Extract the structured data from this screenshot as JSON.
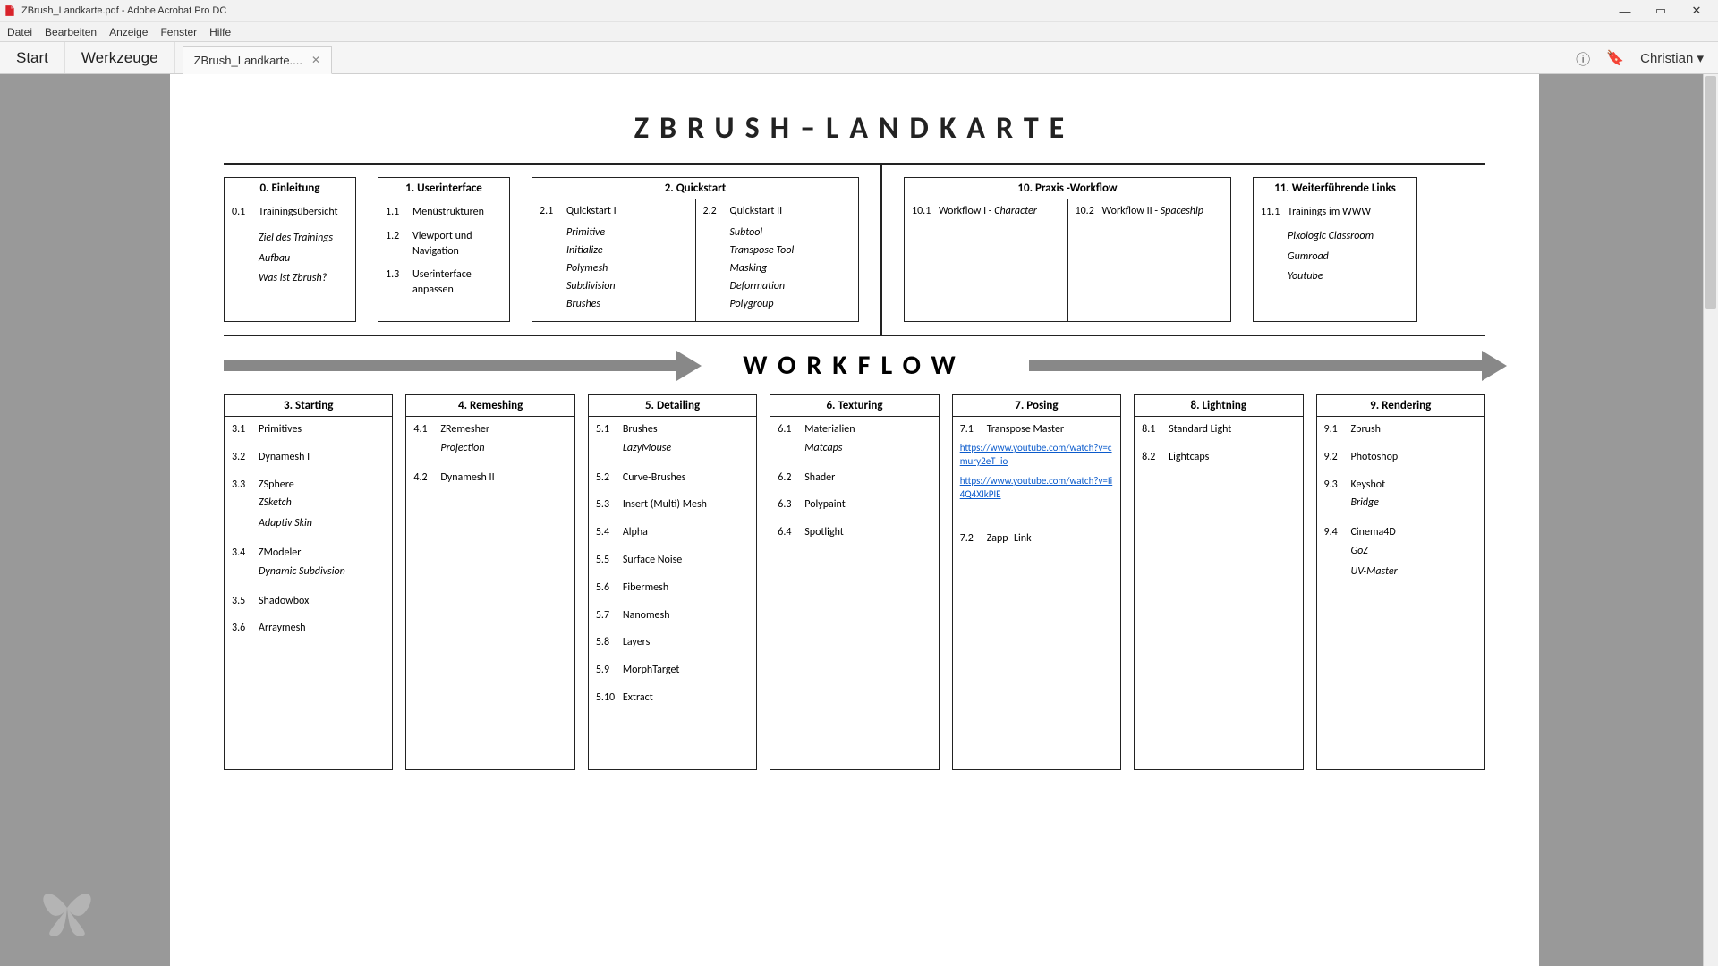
{
  "window": {
    "title": "ZBrush_Landkarte.pdf - Adobe Acrobat Pro DC"
  },
  "menu": {
    "items": [
      "Datei",
      "Bearbeiten",
      "Anzeige",
      "Fenster",
      "Hilfe"
    ]
  },
  "toolbar": {
    "start": "Start",
    "tools": "Werkzeuge",
    "tab_label": "ZBrush_Landkarte....",
    "username": "Christian"
  },
  "doc": {
    "title": "ZBRUSH–LANDKARTE",
    "workflow_label": "WORKFLOW",
    "top_cards": {
      "c0": {
        "head": "0. Einleitung",
        "rows": [
          {
            "num": "0.1",
            "label": "Trainingsübersicht"
          }
        ],
        "subs": [
          "Ziel des Trainings",
          "Aufbau",
          "Was ist Zbrush?"
        ]
      },
      "c1": {
        "head": "1. Userinterface",
        "rows": [
          {
            "num": "1.1",
            "label": "Menüstrukturen"
          },
          {
            "num": "1.2",
            "label": "Viewport und Navigation"
          },
          {
            "num": "1.3",
            "label": "Userinterface anpassen"
          }
        ]
      },
      "c2": {
        "head": "2. Quickstart",
        "col1": {
          "rows": [
            {
              "num": "2.1",
              "label": "Quickstart I"
            }
          ],
          "subs": [
            "Primitive",
            "Initialize",
            "Polymesh",
            "Subdivision",
            "Brushes"
          ]
        },
        "col2": {
          "rows": [
            {
              "num": "2.2",
              "label": "Quickstart II"
            }
          ],
          "subs": [
            "Subtool",
            "Transpose Tool",
            "Masking",
            "Deformation",
            "Polygroup"
          ]
        }
      },
      "c10": {
        "head": "10. Praxis -Workflow",
        "col1": {
          "rows": [
            {
              "num": "10.1",
              "label": "Workflow I - ",
              "em": "Character"
            }
          ]
        },
        "col2": {
          "rows": [
            {
              "num": "10.2",
              "label": "Workflow II - ",
              "em": "Spaceship"
            }
          ]
        }
      },
      "c11": {
        "head": "11. Weiterführende Links",
        "rows": [
          {
            "num": "11.1",
            "label": "Trainings im WWW"
          }
        ],
        "subs": [
          "Pixologic Classroom",
          "Gumroad",
          "Youtube"
        ]
      }
    },
    "bottom_cards": {
      "c3": {
        "head": "3. Starting",
        "items": [
          {
            "num": "3.1",
            "label": "Primitives"
          },
          {
            "num": "3.2",
            "label": "Dynamesh I"
          },
          {
            "num": "3.3",
            "label": "ZSphere",
            "subs": [
              "ZSketch",
              "Adaptiv Skin"
            ]
          },
          {
            "num": "3.4",
            "label": "ZModeler",
            "subs": [
              "Dynamic Subdivsion"
            ]
          },
          {
            "num": "3.5",
            "label": "Shadowbox"
          },
          {
            "num": "3.6",
            "label": "Arraymesh"
          }
        ]
      },
      "c4": {
        "head": "4. Remeshing",
        "items": [
          {
            "num": "4.1",
            "label": "ZRemesher",
            "subs": [
              "Projection"
            ]
          },
          {
            "num": "4.2",
            "label": "Dynamesh II"
          }
        ]
      },
      "c5": {
        "head": "5. Detailing",
        "items": [
          {
            "num": "5.1",
            "label": "Brushes",
            "subs": [
              "LazyMouse"
            ]
          },
          {
            "num": "5.2",
            "label": "Curve-Brushes"
          },
          {
            "num": "5.3",
            "label": "Insert (Multi) Mesh"
          },
          {
            "num": "5.4",
            "label": "Alpha"
          },
          {
            "num": "5.5",
            "label": "Surface Noise"
          },
          {
            "num": "5.6",
            "label": "Fibermesh"
          },
          {
            "num": "5.7",
            "label": "Nanomesh"
          },
          {
            "num": "5.8",
            "label": "Layers"
          },
          {
            "num": "5.9",
            "label": "MorphTarget"
          },
          {
            "num": "5.10",
            "label": "Extract"
          }
        ]
      },
      "c6": {
        "head": "6. Texturing",
        "items": [
          {
            "num": "6.1",
            "label": "Materialien",
            "subs": [
              "Matcaps"
            ]
          },
          {
            "num": "6.2",
            "label": "Shader"
          },
          {
            "num": "6.3",
            "label": "Polypaint"
          },
          {
            "num": "6.4",
            "label": "Spotlight"
          }
        ]
      },
      "c7": {
        "head": "7. Posing",
        "items": [
          {
            "num": "7.1",
            "label": "Transpose Master",
            "links": [
              "https://www.youtube.com/watch?v=cmury2eT_io",
              "https://www.youtube.com/watch?v=Ii4Q4XIkPIE"
            ]
          },
          {
            "num": "7.2",
            "label": "Zapp -Link"
          }
        ]
      },
      "c8": {
        "head": "8. Lightning",
        "items": [
          {
            "num": "8.1",
            "label": "Standard Light"
          },
          {
            "num": "8.2",
            "label": "Lightcaps"
          }
        ]
      },
      "c9": {
        "head": "9. Rendering",
        "items": [
          {
            "num": "9.1",
            "label": "Zbrush"
          },
          {
            "num": "9.2",
            "label": "Photoshop"
          },
          {
            "num": "9.3",
            "label": "Keyshot",
            "subs": [
              "Bridge"
            ]
          },
          {
            "num": "9.4",
            "label": "Cinema4D",
            "subs": [
              "GoZ",
              "UV-Master"
            ]
          }
        ]
      }
    }
  }
}
